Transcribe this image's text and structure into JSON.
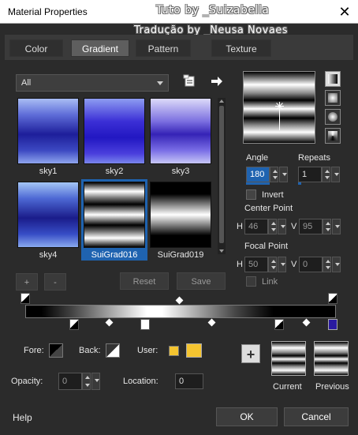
{
  "window": {
    "title": "Material Properties",
    "watermark_1": "Tuto by _Suizabella",
    "watermark_2": "Tradução by _Neusa Novaes",
    "close_glyph": "✕"
  },
  "tabs": [
    {
      "label": "Color"
    },
    {
      "label": "Gradient"
    },
    {
      "label": "Pattern"
    },
    {
      "label": "Texture"
    }
  ],
  "gradient_panel": {
    "category_value": "All",
    "swatches": [
      {
        "label": "sky1"
      },
      {
        "label": "sky2"
      },
      {
        "label": "sky3"
      },
      {
        "label": "sky4"
      },
      {
        "label": "SuiGrad016"
      },
      {
        "label": "SuiGrad019"
      }
    ],
    "selected_swatch": "SuiGrad016"
  },
  "buttons": {
    "add": "+",
    "remove": "-",
    "reset": "Reset",
    "save": "Save",
    "ok": "OK",
    "cancel": "Cancel",
    "help": "Help",
    "add_swatch": "+"
  },
  "settings": {
    "angle_label": "Angle",
    "angle_value": "180",
    "repeats_label": "Repeats",
    "repeats_value": "1",
    "invert_label": "Invert",
    "center_point_label": "Center Point",
    "center_h_label": "H",
    "center_h_value": "46",
    "center_v_label": "V",
    "center_v_value": "95",
    "focal_point_label": "Focal Point",
    "focal_h_label": "H",
    "focal_h_value": "50",
    "focal_v_label": "V",
    "focal_v_value": "0",
    "link_label": "Link"
  },
  "stops": {
    "fore_label": "Fore:",
    "back_label": "Back:",
    "user_label": "User:",
    "opacity_label": "Opacity:",
    "opacity_value": "0",
    "location_label": "Location:",
    "location_value": "0",
    "user_color": "#f4c430"
  },
  "preview": {
    "current_label": "Current",
    "previous_label": "Previous"
  }
}
